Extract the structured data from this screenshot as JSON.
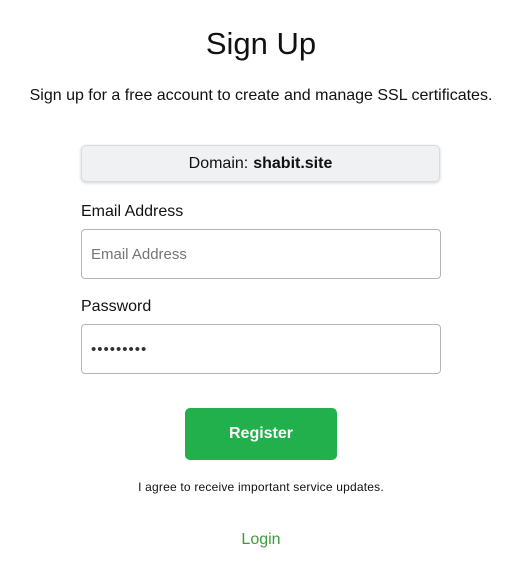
{
  "page": {
    "title": "Sign Up",
    "subtitle": "Sign up for a free account to create and manage SSL certificates."
  },
  "domain": {
    "label": "Domain:",
    "value": "shabit.site"
  },
  "form": {
    "email": {
      "label": "Email Address",
      "placeholder": "Email Address",
      "value": ""
    },
    "password": {
      "label": "Password",
      "value": "•••••••••"
    },
    "register_label": "Register",
    "agree_text": "I agree to receive important service updates.",
    "login_label": "Login"
  },
  "colors": {
    "primary_button": "#21b04b",
    "link": "#3d9c3a",
    "domain_box_bg": "#f0f1f3"
  }
}
